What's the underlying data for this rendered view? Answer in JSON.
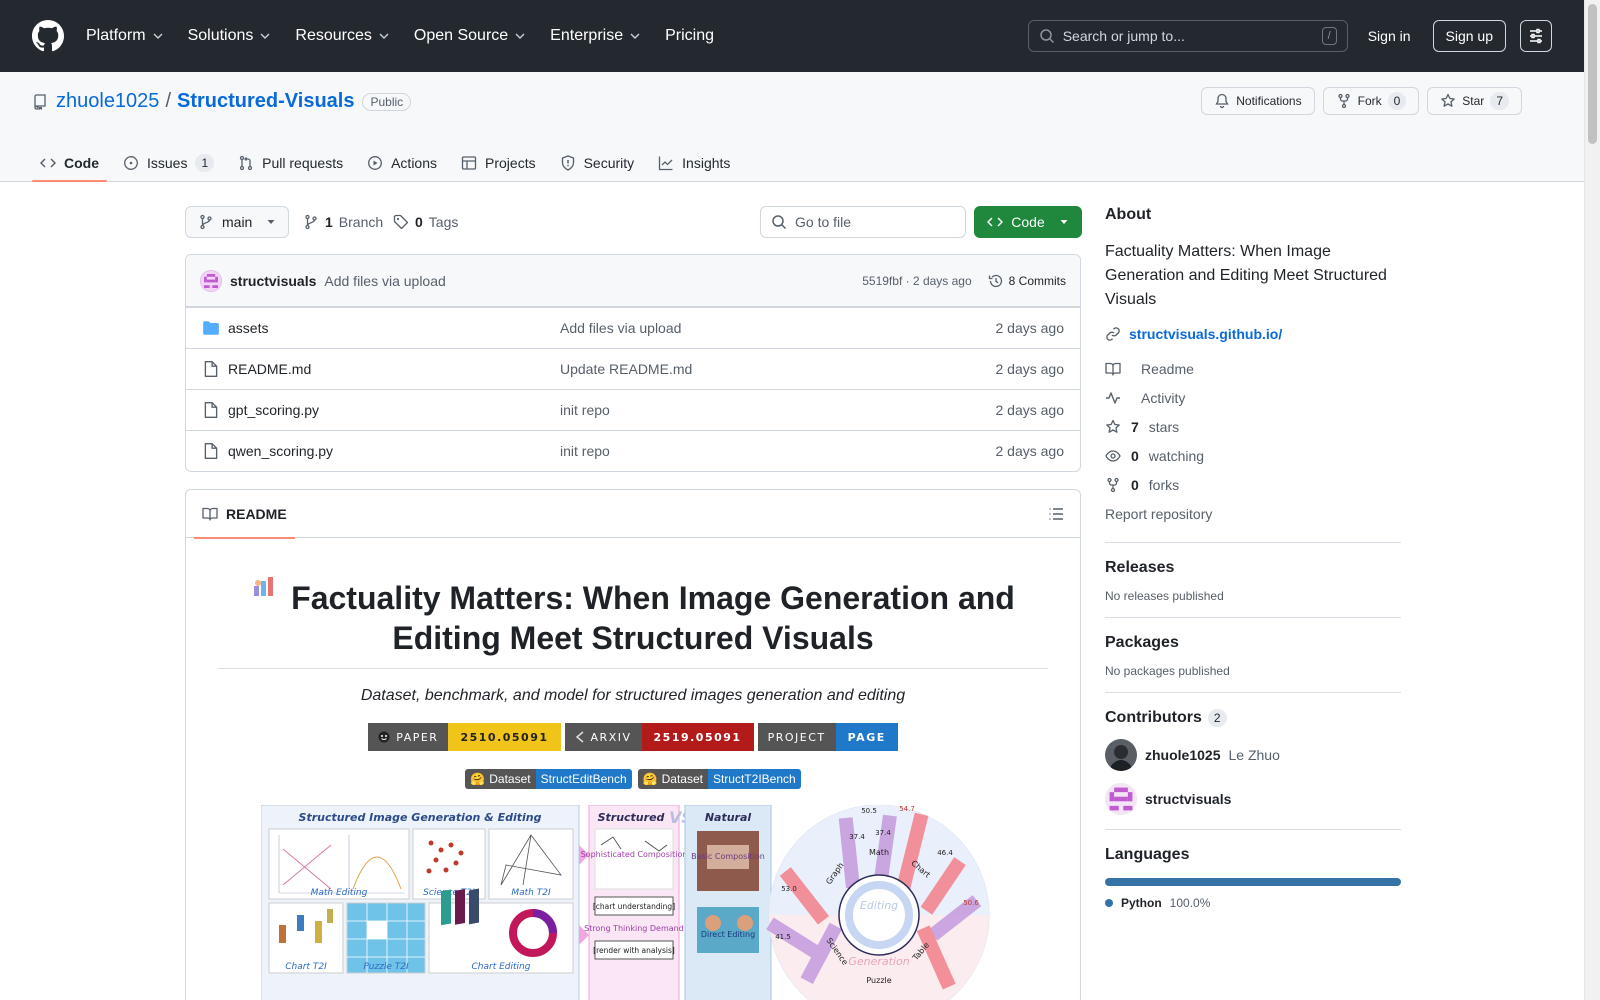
{
  "header": {
    "nav": [
      {
        "label": "Platform",
        "dropdown": true
      },
      {
        "label": "Solutions",
        "dropdown": true
      },
      {
        "label": "Resources",
        "dropdown": true
      },
      {
        "label": "Open Source",
        "dropdown": true
      },
      {
        "label": "Enterprise",
        "dropdown": true
      },
      {
        "label": "Pricing",
        "dropdown": false
      }
    ],
    "search_placeholder": "Search or jump to...",
    "search_shortcut": "/",
    "sign_in": "Sign in",
    "sign_up": "Sign up"
  },
  "repo": {
    "owner": "zhuole1025",
    "separator": "/",
    "name": "Structured-Visuals",
    "visibility": "Public",
    "notifications_label": "Notifications",
    "fork_label": "Fork",
    "fork_count": "0",
    "star_label": "Star",
    "star_count": "7"
  },
  "tabs": [
    {
      "label": "Code",
      "icon": "code-icon",
      "active": true
    },
    {
      "label": "Issues",
      "icon": "issue-icon",
      "count": "1"
    },
    {
      "label": "Pull requests",
      "icon": "pull-request-icon"
    },
    {
      "label": "Actions",
      "icon": "play-icon"
    },
    {
      "label": "Projects",
      "icon": "table-icon"
    },
    {
      "label": "Security",
      "icon": "shield-icon"
    },
    {
      "label": "Insights",
      "icon": "graph-icon"
    }
  ],
  "toolbar": {
    "branch": "main",
    "branch_count": "1",
    "branch_label": "Branch",
    "tag_count": "0",
    "tag_label": "Tags",
    "go_to_file": "Go to file",
    "code_button": "Code"
  },
  "latest_commit": {
    "author": "structvisuals",
    "message": "Add files via upload",
    "meta": "5519fbf · 2 days ago",
    "commits_label": "8 Commits"
  },
  "files": [
    {
      "name": "assets",
      "type": "folder",
      "message": "Add files via upload",
      "date": "2 days ago"
    },
    {
      "name": "README.md",
      "type": "file",
      "message": "Update README.md",
      "date": "2 days ago"
    },
    {
      "name": "gpt_scoring.py",
      "type": "file",
      "message": "init repo",
      "date": "2 days ago"
    },
    {
      "name": "qwen_scoring.py",
      "type": "file",
      "message": "init repo",
      "date": "2 days ago"
    }
  ],
  "readme": {
    "tab_label": "README",
    "title": "Factuality Matters: When Image Generation and Editing Meet Structured Visuals",
    "subtitle": "Dataset, benchmark, and model for structured images generation and editing",
    "badges": [
      {
        "left": "PAPER",
        "right": "2510.05091",
        "color": "#f0c419"
      },
      {
        "left": "ARXIV",
        "right": "2519.05091",
        "color": "#b31b1b"
      },
      {
        "left": "PROJECT",
        "right": "PAGE",
        "color": "#1f78c8"
      }
    ],
    "dataset_badges": [
      {
        "left": "Dataset",
        "right": "StructEditBench"
      },
      {
        "left": "Dataset",
        "right": "StructT2IBench"
      }
    ],
    "figure": {
      "left_title": "Structured Image Generation & Editing",
      "structured_label": "Structured",
      "vs_label": "VS",
      "natural_label": "Natural",
      "tile_labels": [
        "Math Editing",
        "Science T2I",
        "Math T2I",
        "Chart T2I",
        "Puzzle T2I",
        "Chart Editing"
      ],
      "structured_items": [
        "Sophisticated Composition",
        "[chart understanding]",
        "Strong Thinking Demand",
        "[render with analysis]"
      ],
      "natural_items": [
        "Basic Composition",
        "Direct Editing"
      ],
      "radial_labels": [
        "Math",
        "Chart",
        "Graph",
        "Table",
        "Puzzle",
        "Science"
      ],
      "radial_center_top": "Editing",
      "radial_center_bottom": "Generation",
      "radial_values": [
        "50.5",
        "54.7",
        "37.4",
        "37.4",
        "46.4",
        "50.6",
        "53.0",
        "41.5"
      ]
    }
  },
  "about": {
    "heading": "About",
    "description": "Factuality Matters: When Image Generation and Editing Meet Structured Visuals",
    "website": "structvisuals.github.io/",
    "items": [
      {
        "icon": "book-icon",
        "bold": "",
        "text": "Readme"
      },
      {
        "icon": "pulse-icon",
        "bold": "",
        "text": "Activity"
      },
      {
        "icon": "star-icon",
        "bold": "7",
        "text": "stars"
      },
      {
        "icon": "eye-icon",
        "bold": "0",
        "text": "watching"
      },
      {
        "icon": "fork-icon",
        "bold": "0",
        "text": "forks"
      }
    ],
    "report": "Report repository"
  },
  "releases": {
    "heading": "Releases",
    "empty": "No releases published"
  },
  "packages": {
    "heading": "Packages",
    "empty": "No packages published"
  },
  "contributors": {
    "heading": "Contributors",
    "count": "2",
    "list": [
      {
        "login": "zhuole1025",
        "name": "Le Zhuo"
      },
      {
        "login": "structvisuals",
        "name": ""
      }
    ]
  },
  "languages": {
    "heading": "Languages",
    "list": [
      {
        "name": "Python",
        "percent": "100.0%",
        "color": "#3572A5",
        "fraction": 1.0
      }
    ]
  }
}
